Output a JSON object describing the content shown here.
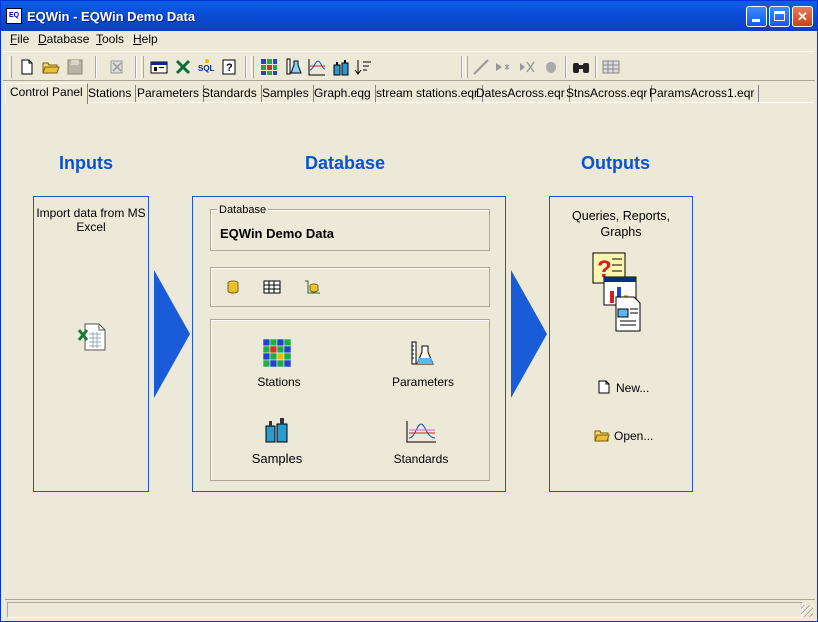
{
  "window": {
    "title": "EQWin - EQWin Demo Data",
    "app_icon_text": "EQ"
  },
  "menu": [
    {
      "label": "File"
    },
    {
      "label": "Database"
    },
    {
      "label": "Tools"
    },
    {
      "label": "Help"
    }
  ],
  "toolbar": {
    "icons": [
      "new-file-icon",
      "open-folder-icon",
      "save-icon",
      "delete-icon",
      "report-icon",
      "excel-icon",
      "sql-icon",
      "query-help-icon",
      "stations-grid-icon",
      "parameters-flask-icon",
      "standards-chart-icon",
      "samples-bottles-icon",
      "sort-icon",
      "draw-line-icon",
      "arrow-point-icon",
      "delete-point-icon",
      "hand-icon",
      "binoculars-icon",
      "table-icon"
    ]
  },
  "tabs": [
    {
      "label": "Control Panel",
      "active": true
    },
    {
      "label": "Stations"
    },
    {
      "label": "Parameters"
    },
    {
      "label": "Standards"
    },
    {
      "label": "Samples"
    },
    {
      "label": "Graph.eqg"
    },
    {
      "label": "stream stations.eqr"
    },
    {
      "label": "DatesAcross.eqr"
    },
    {
      "label": "StnsAcross.eqr"
    },
    {
      "label": "ParamsAcross1.eqr"
    }
  ],
  "inputs": {
    "heading": "Inputs",
    "import_label": "Import data from MS Excel"
  },
  "database": {
    "heading": "Database",
    "group_label": "Database",
    "name": "EQWin Demo Data",
    "items": {
      "stations": "Stations",
      "parameters": "Parameters",
      "samples": "Samples",
      "standards": "Standards"
    }
  },
  "outputs": {
    "heading": "Outputs",
    "caption": "Queries, Reports, Graphs",
    "new_label": "New...",
    "open_label": "Open..."
  },
  "colors": {
    "accent": "#0a52d0",
    "arrow": "#1a5cd8",
    "face": "#ece9d8"
  }
}
